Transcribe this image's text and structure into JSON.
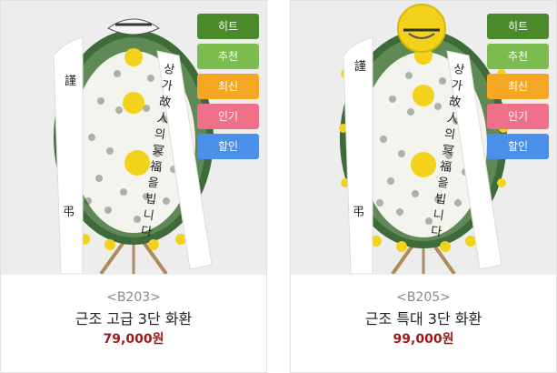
{
  "colors": {
    "hit": "#4a8a2a",
    "recommend": "#7cbc4e",
    "new": "#f5a623",
    "popular": "#f0708a",
    "sale": "#4a8fe8",
    "price": "#a01a1a"
  },
  "products": [
    {
      "code": "<B203>",
      "name": "근조 고급 3단 화환",
      "price": "79,000원",
      "badges": [
        "히트",
        "추천",
        "최신",
        "인기",
        "할인"
      ],
      "ribbon_right": [
        "상",
        "가",
        "故",
        "人",
        "의",
        "冥",
        "福",
        "을",
        "빕",
        "니",
        "다"
      ],
      "ribbon_left": [
        "謹",
        "弔"
      ]
    },
    {
      "code": "<B205>",
      "name": "근조 특대 3단 화환",
      "price": "99,000원",
      "badges": [
        "히트",
        "추천",
        "최신",
        "인기",
        "할인"
      ],
      "ribbon_right": [
        "상",
        "가",
        "故",
        "人",
        "의",
        "冥",
        "福",
        "을",
        "빕",
        "니",
        "다"
      ],
      "ribbon_left": [
        "謹",
        "弔"
      ]
    }
  ]
}
